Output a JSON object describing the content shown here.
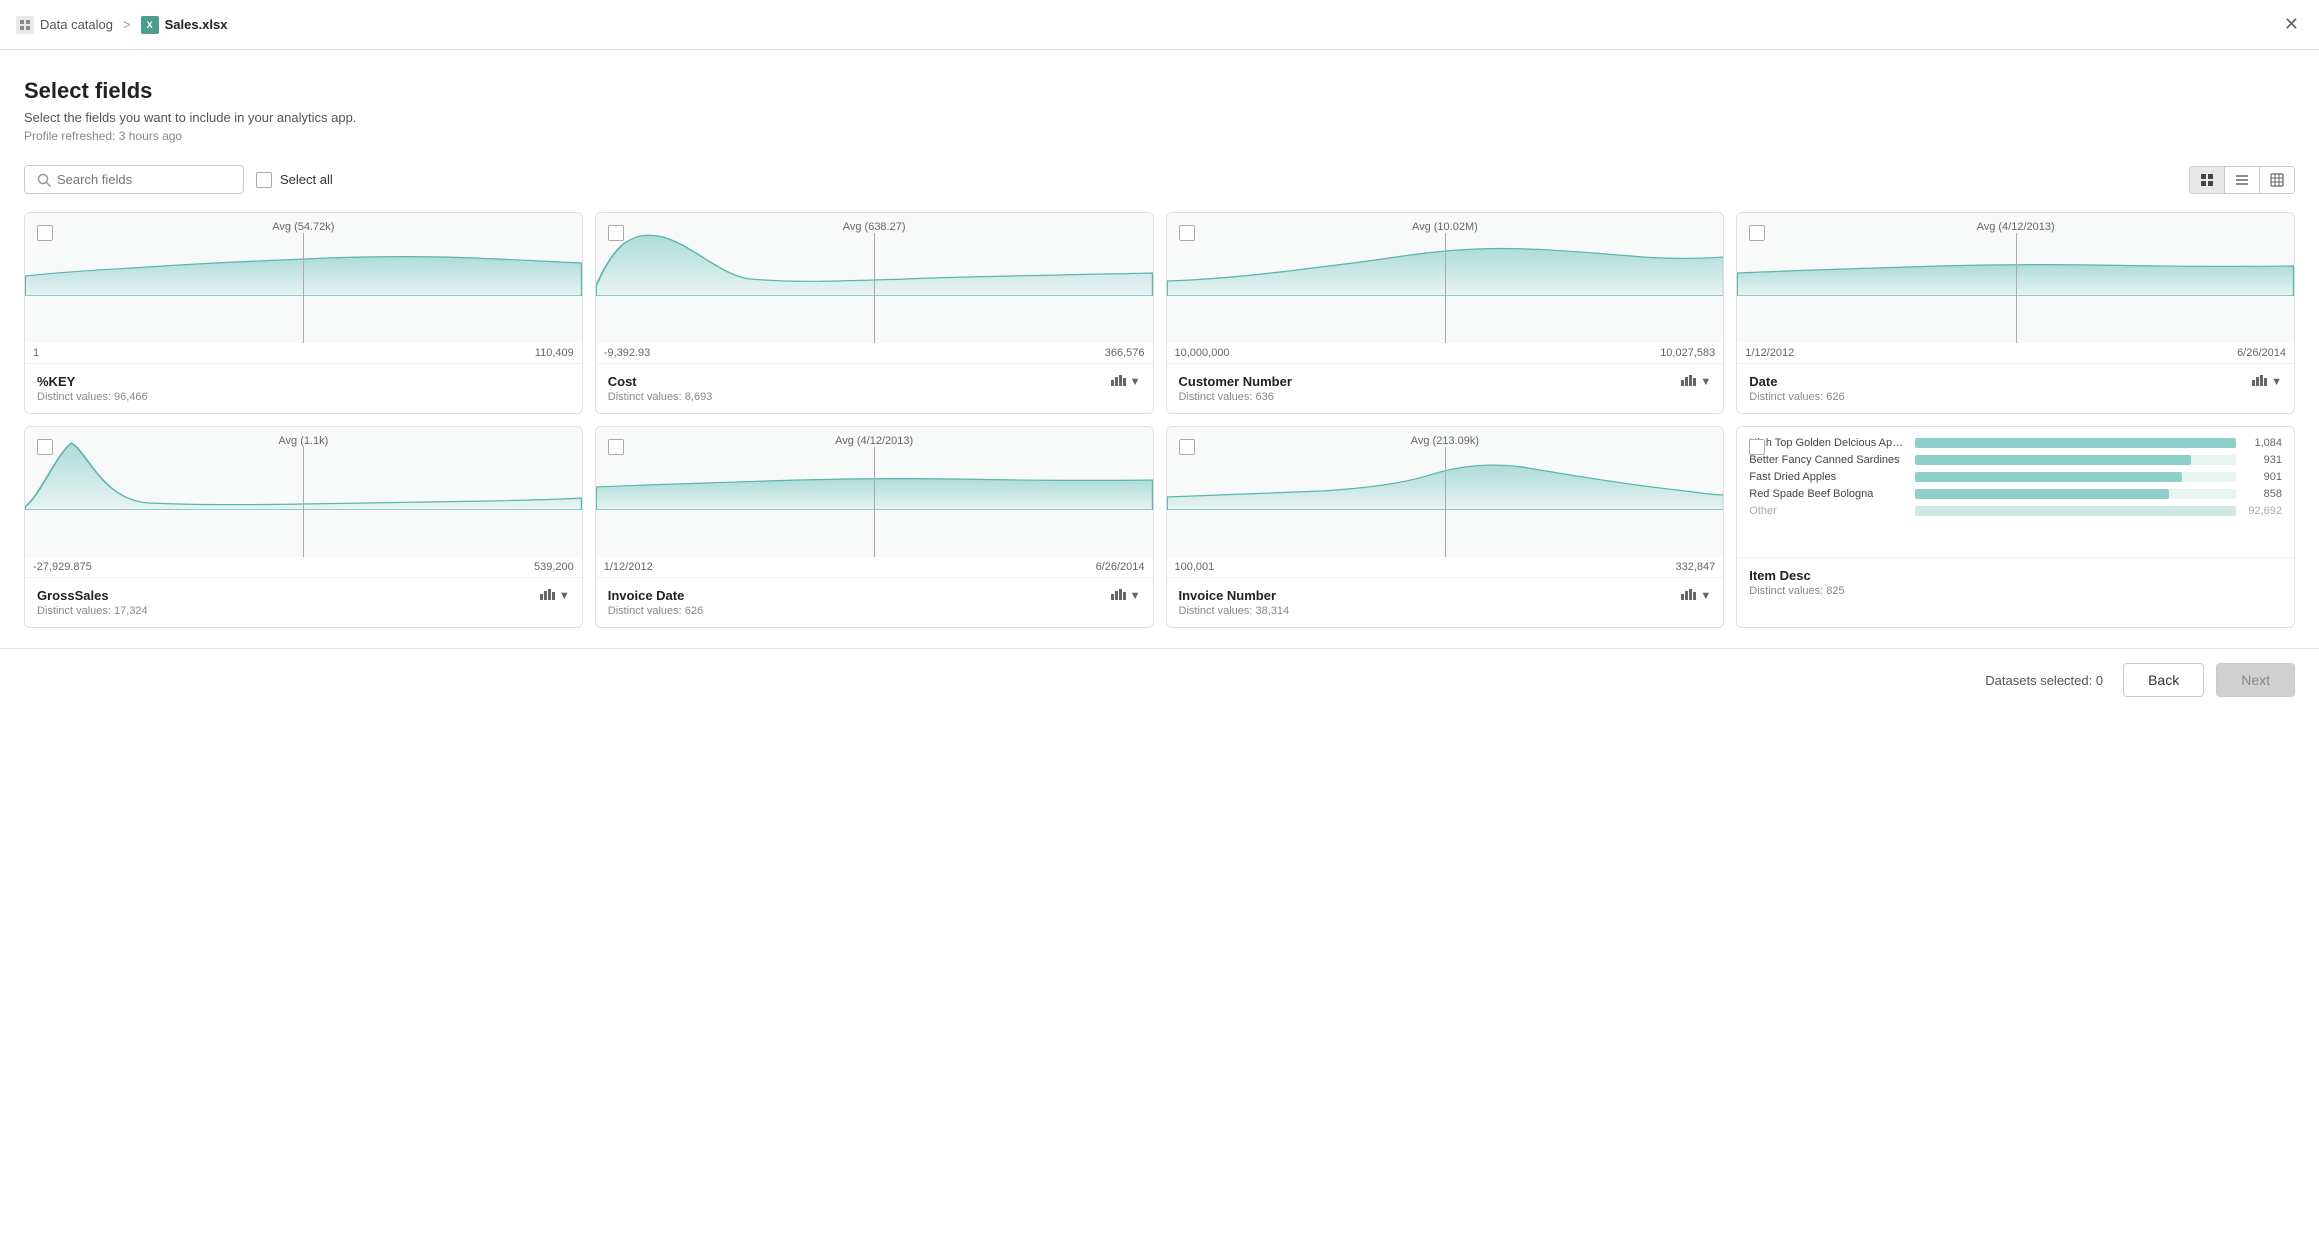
{
  "breadcrumb": {
    "catalog_label": "Data catalog",
    "separator": ">",
    "file_label": "Sales.xlsx"
  },
  "page": {
    "title": "Select fields",
    "subtitle": "Select the fields you want to include in your analytics app.",
    "refresh_text": "Profile refreshed: 3 hours ago"
  },
  "toolbar": {
    "search_placeholder": "Search fields",
    "select_all_label": "Select all"
  },
  "view_modes": [
    "grid",
    "list",
    "table"
  ],
  "cards": [
    {
      "id": "percent_key",
      "field_name": "%KEY",
      "distinct_label": "Distinct values: 96,466",
      "avg_label": "Avg (54.72k)",
      "range_min": "1",
      "range_max": "110,409",
      "chart_type": "area",
      "has_dropdown": false
    },
    {
      "id": "cost",
      "field_name": "Cost",
      "distinct_label": "Distinct values: 8,693",
      "avg_label": "Avg (638.27)",
      "range_min": "-9,392.93",
      "range_max": "366,576",
      "chart_type": "area",
      "has_dropdown": true
    },
    {
      "id": "customer_number",
      "field_name": "Customer Number",
      "distinct_label": "Distinct values: 636",
      "avg_label": "Avg (10.02M)",
      "range_min": "10,000,000",
      "range_max": "10,027,583",
      "chart_type": "area",
      "has_dropdown": true
    },
    {
      "id": "date",
      "field_name": "Date",
      "distinct_label": "Distinct values: 626",
      "avg_label": "Avg (4/12/2013)",
      "range_min": "1/12/2012",
      "range_max": "6/26/2014",
      "chart_type": "area",
      "has_dropdown": true
    },
    {
      "id": "gross_sales",
      "field_name": "GrossSales",
      "distinct_label": "Distinct values: 17,324",
      "avg_label": "Avg (1.1k)",
      "range_min": "-27,929.875",
      "range_max": "539,200",
      "chart_type": "area",
      "has_dropdown": true
    },
    {
      "id": "invoice_date",
      "field_name": "Invoice Date",
      "distinct_label": "Distinct values: 626",
      "avg_label": "Avg (4/12/2013)",
      "range_min": "1/12/2012",
      "range_max": "6/26/2014",
      "chart_type": "area",
      "has_dropdown": true
    },
    {
      "id": "invoice_number",
      "field_name": "Invoice Number",
      "distinct_label": "Distinct values: 38,314",
      "avg_label": "Avg (213.09k)",
      "range_min": "100,001",
      "range_max": "332,847",
      "chart_type": "area",
      "has_dropdown": true
    },
    {
      "id": "item_desc",
      "field_name": "Item Desc",
      "distinct_label": "Distinct values: 825",
      "chart_type": "bar",
      "bar_items": [
        {
          "label": "High Top Golden Delcious Apples",
          "count": 1084,
          "max": 1084
        },
        {
          "label": "Better Fancy Canned Sardines",
          "count": 931,
          "max": 1084
        },
        {
          "label": "Fast Dried Apples",
          "count": 901,
          "max": 1084
        },
        {
          "label": "Red Spade Beef Bologna",
          "count": 858,
          "max": 1084
        },
        {
          "label": "Other",
          "count": 92692,
          "max": 1084
        }
      ]
    }
  ],
  "bottom_bar": {
    "datasets_info": "Datasets selected: 0",
    "back_label": "Back",
    "next_label": "Next"
  }
}
